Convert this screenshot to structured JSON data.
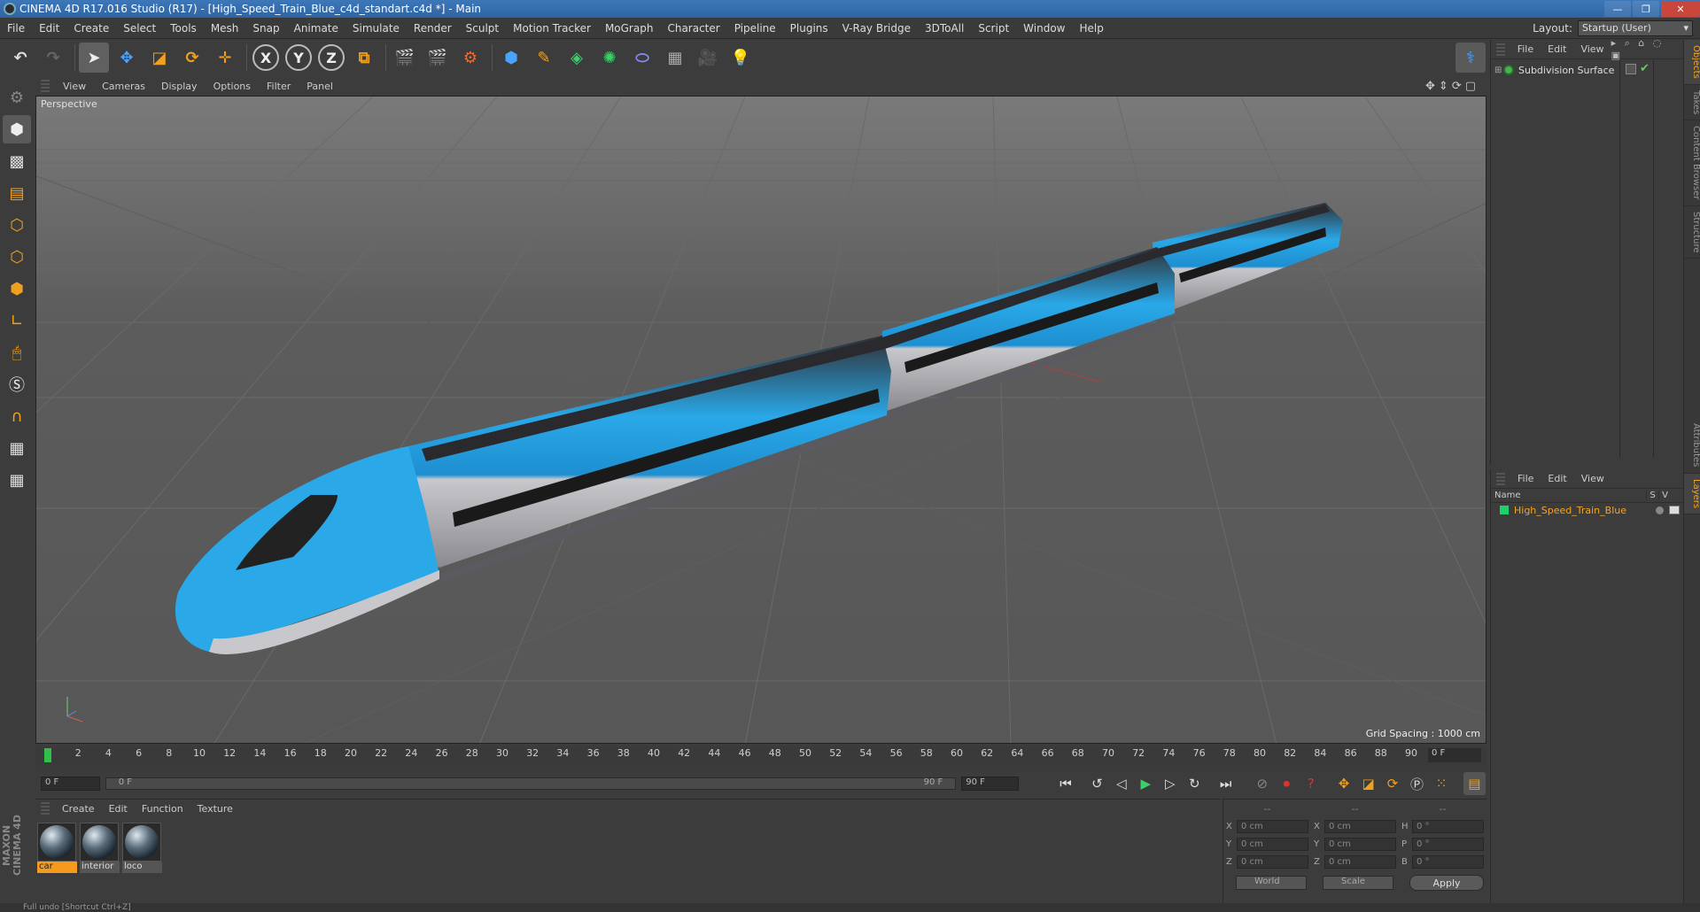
{
  "window": {
    "title": "CINEMA 4D R17.016 Studio (R17) - [High_Speed_Train_Blue_c4d_standart.c4d *] - Main",
    "controls": [
      "—",
      "❐",
      "✕"
    ]
  },
  "menubar": {
    "items": [
      "File",
      "Edit",
      "Create",
      "Select",
      "Tools",
      "Mesh",
      "Snap",
      "Animate",
      "Simulate",
      "Render",
      "Sculpt",
      "Motion Tracker",
      "MoGraph",
      "Character",
      "Pipeline",
      "Plugins",
      "V-Ray Bridge",
      "3DToAll",
      "Script",
      "Window",
      "Help"
    ],
    "layout_label": "Layout:",
    "layout_value": "Startup (User)"
  },
  "toolbar": {
    "axis_x": "X",
    "axis_y": "Y",
    "axis_z": "Z"
  },
  "viewport": {
    "menu": [
      "View",
      "Cameras",
      "Display",
      "Options",
      "Filter",
      "Panel"
    ],
    "camera_label": "Perspective",
    "grid_spacing": "Grid Spacing : 1000 cm"
  },
  "timeline": {
    "ticks": [
      "0",
      "2",
      "4",
      "6",
      "8",
      "10",
      "12",
      "14",
      "16",
      "18",
      "20",
      "22",
      "24",
      "26",
      "28",
      "30",
      "32",
      "34",
      "36",
      "38",
      "40",
      "42",
      "44",
      "46",
      "48",
      "50",
      "52",
      "54",
      "56",
      "58",
      "60",
      "62",
      "64",
      "66",
      "68",
      "70",
      "72",
      "74",
      "76",
      "78",
      "80",
      "82",
      "84",
      "86",
      "88",
      "90"
    ],
    "current_frame": "0 F"
  },
  "transport": {
    "start_field": "0 F",
    "range_start": "0 F",
    "range_end": "90 F",
    "end_field": "90 F"
  },
  "materials": {
    "menu": [
      "Create",
      "Edit",
      "Function",
      "Texture"
    ],
    "items": [
      {
        "name": "car",
        "selected": true
      },
      {
        "name": "interior",
        "selected": false
      },
      {
        "name": "loco",
        "selected": false
      }
    ]
  },
  "coordinates": {
    "headers": [
      "--",
      "--",
      "--"
    ],
    "rows": [
      {
        "a_label": "X",
        "a_val": "0 cm",
        "b_label": "X",
        "b_val": "0 cm",
        "c_label": "H",
        "c_val": "0 °"
      },
      {
        "a_label": "Y",
        "a_val": "0 cm",
        "b_label": "Y",
        "b_val": "0 cm",
        "c_label": "P",
        "c_val": "0 °"
      },
      {
        "a_label": "Z",
        "a_val": "0 cm",
        "b_label": "Z",
        "b_val": "0 cm",
        "c_label": "B",
        "c_val": "0 °"
      }
    ],
    "world_select": "World",
    "scale_select": "Scale",
    "apply_label": "Apply"
  },
  "objects_panel": {
    "menu": [
      "File",
      "Edit",
      "View"
    ],
    "objects": [
      {
        "name": "Subdivision Surface"
      }
    ]
  },
  "layers_panel": {
    "menu": [
      "File",
      "Edit",
      "View"
    ],
    "col_name": "Name",
    "col_s": "S",
    "col_v": "V",
    "layers": [
      {
        "name": "High_Speed_Train_Blue",
        "color": "#1fd16b"
      }
    ]
  },
  "side_tabs": [
    "Objects",
    "Takes",
    "Content Browser",
    "Structure",
    "Attributes",
    "Layers"
  ],
  "status": {
    "text": "Full undo [Shortcut Ctrl+Z]"
  },
  "branding": {
    "logo": "MAXON CINEMA 4D"
  },
  "colors": {
    "accent_orange": "#f5a524",
    "train_blue": "#2aa8e8",
    "layer_green": "#1fd16b"
  }
}
